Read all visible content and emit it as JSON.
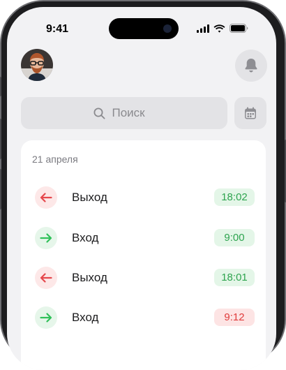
{
  "status_bar": {
    "time": "9:41"
  },
  "header": {
    "avatar_icon": "user-avatar-photo",
    "bell_icon": "bell-icon"
  },
  "search": {
    "placeholder": "Поиск",
    "icon": "search-icon"
  },
  "calendar_icon": "calendar-icon",
  "log": {
    "date": "21 апреля",
    "entries": [
      {
        "type": "exit",
        "label": "Выход",
        "time": "18:02",
        "status": "ok"
      },
      {
        "type": "entry",
        "label": "Вход",
        "time": "9:00",
        "status": "ok"
      },
      {
        "type": "exit",
        "label": "Выход",
        "time": "18:01",
        "status": "ok"
      },
      {
        "type": "entry",
        "label": "Вход",
        "time": "9:12",
        "status": "late"
      }
    ]
  },
  "colors": {
    "exit_arrow": "#e5484d",
    "entry_arrow": "#30c15a",
    "time_ok_text": "#2ea44f",
    "time_late_text": "#e03b3b"
  }
}
